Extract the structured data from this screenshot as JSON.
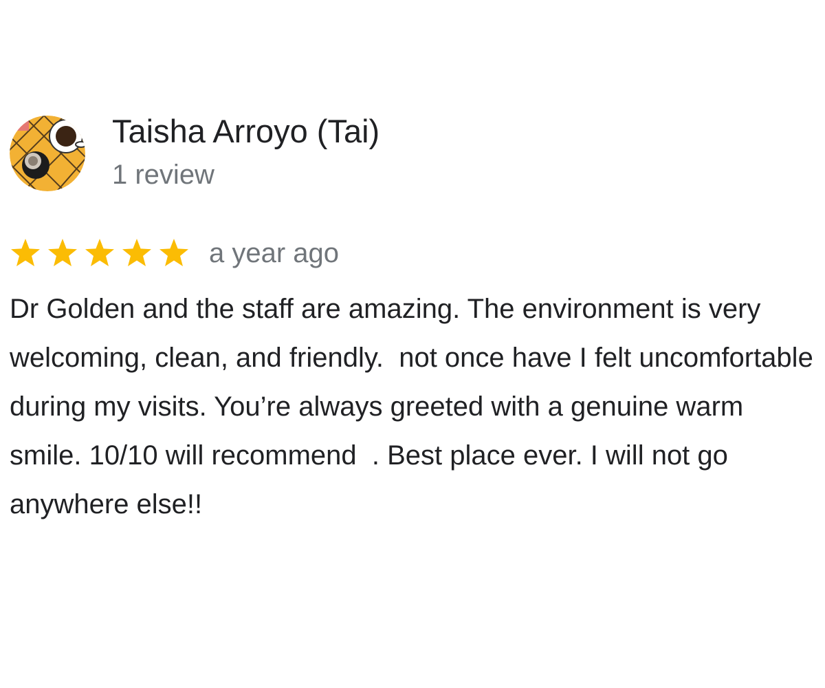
{
  "review": {
    "author": {
      "name": "Taisha Arroyo (Tai)",
      "review_count": "1 review",
      "avatar_icon": "profile-photo-avatar"
    },
    "rating": {
      "stars": 5,
      "max_stars": 5,
      "star_color": "#fbbc04"
    },
    "time": "a year ago",
    "text": "Dr Golden and the staff are amazing. The environment is very welcoming, clean, and friendly.  not once have I felt uncomfortable during my visits. You’re always greeted with a genuine warm smile. 10/10 will recommend  . Best place ever. I will not go anywhere else!!"
  },
  "colors": {
    "primary_text": "#202124",
    "secondary_text": "#70757a",
    "star": "#fbbc04"
  }
}
